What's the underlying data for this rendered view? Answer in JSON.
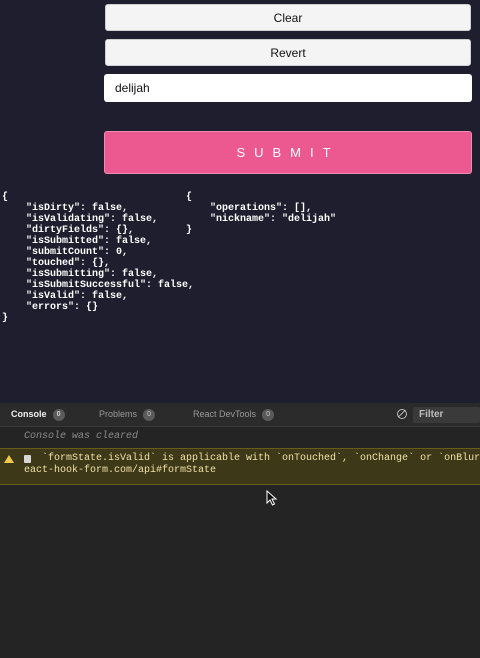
{
  "form": {
    "clear_label": "Clear",
    "revert_label": "Revert",
    "nickname_value": "delijah",
    "submit_label": "SUBMIT"
  },
  "form_state_json": "{\n    \"isDirty\": false,\n    \"isValidating\": false,\n    \"dirtyFields\": {},\n    \"isSubmitted\": false,\n    \"submitCount\": 0,\n    \"touched\": {},\n    \"isSubmitting\": false,\n    \"isSubmitSuccessful\": false,\n    \"isValid\": false,\n    \"errors\": {}\n}",
  "values_json": "{\n    \"operations\": [],\n    \"nickname\": \"delijah\"\n}",
  "devtools": {
    "tabs": [
      {
        "label": "Console",
        "count": "0"
      },
      {
        "label": "Problems",
        "count": "0"
      },
      {
        "label": "React DevTools",
        "count": "0"
      }
    ],
    "filter_label": "Filter",
    "cleared_message": "Console was cleared",
    "warning_line1": "   `formState.isValid` is applicable with `onTouched`, `onChange` or `onBlur` mo",
    "warning_line2": "eact-hook-form.com/api#formState",
    "icons": [
      "clear-console-icon",
      "warning-icon",
      "clipboard-icon",
      "mouse-cursor-icon"
    ]
  }
}
